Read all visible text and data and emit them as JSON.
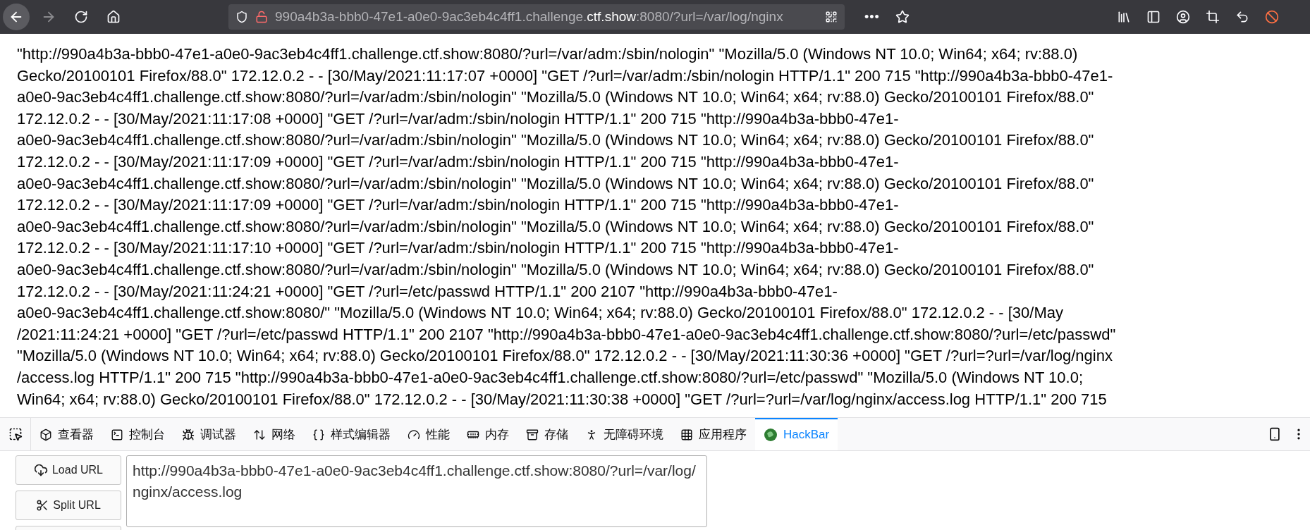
{
  "browser": {
    "back": {
      "disabled": false
    },
    "forward": {
      "disabled": true
    },
    "url_bar": {
      "prefix": "990a4b3a-bbb0-47e1-a0e0-9ac3eb4c4ff1.challenge.",
      "domain": "ctf.show",
      "suffix": ":8080/?url=/var/log/nginx",
      "menu": "•••"
    }
  },
  "log_lines": [
    "\"http://990a4b3a-bbb0-47e1-a0e0-9ac3eb4c4ff1.challenge.ctf.show:8080/?url=/var/adm:/sbin/nologin\" \"Mozilla/5.0 (Windows NT 10.0; Win64; x64; rv:88.0)",
    "Gecko/20100101 Firefox/88.0\" 172.12.0.2 - - [30/May/2021:11:17:07 +0000] \"GET /?url=/var/adm:/sbin/nologin HTTP/1.1\" 200 715 \"http://990a4b3a-bbb0-47e1-",
    "a0e0-9ac3eb4c4ff1.challenge.ctf.show:8080/?url=/var/adm:/sbin/nologin\" \"Mozilla/5.0 (Windows NT 10.0; Win64; x64; rv:88.0) Gecko/20100101 Firefox/88.0\"",
    "172.12.0.2 - - [30/May/2021:11:17:08 +0000] \"GET /?url=/var/adm:/sbin/nologin HTTP/1.1\" 200 715 \"http://990a4b3a-bbb0-47e1-",
    "a0e0-9ac3eb4c4ff1.challenge.ctf.show:8080/?url=/var/adm:/sbin/nologin\" \"Mozilla/5.0 (Windows NT 10.0; Win64; x64; rv:88.0) Gecko/20100101 Firefox/88.0\"",
    "172.12.0.2 - - [30/May/2021:11:17:09 +0000] \"GET /?url=/var/adm:/sbin/nologin HTTP/1.1\" 200 715 \"http://990a4b3a-bbb0-47e1-",
    "a0e0-9ac3eb4c4ff1.challenge.ctf.show:8080/?url=/var/adm:/sbin/nologin\" \"Mozilla/5.0 (Windows NT 10.0; Win64; x64; rv:88.0) Gecko/20100101 Firefox/88.0\"",
    "172.12.0.2 - - [30/May/2021:11:17:09 +0000] \"GET /?url=/var/adm:/sbin/nologin HTTP/1.1\" 200 715 \"http://990a4b3a-bbb0-47e1-",
    "a0e0-9ac3eb4c4ff1.challenge.ctf.show:8080/?url=/var/adm:/sbin/nologin\" \"Mozilla/5.0 (Windows NT 10.0; Win64; x64; rv:88.0) Gecko/20100101 Firefox/88.0\"",
    "172.12.0.2 - - [30/May/2021:11:17:10 +0000] \"GET /?url=/var/adm:/sbin/nologin HTTP/1.1\" 200 715 \"http://990a4b3a-bbb0-47e1-",
    "a0e0-9ac3eb4c4ff1.challenge.ctf.show:8080/?url=/var/adm:/sbin/nologin\" \"Mozilla/5.0 (Windows NT 10.0; Win64; x64; rv:88.0) Gecko/20100101 Firefox/88.0\"",
    "172.12.0.2 - - [30/May/2021:11:24:21 +0000] \"GET /?url=/etc/passwd HTTP/1.1\" 200 2107 \"http://990a4b3a-bbb0-47e1-",
    "a0e0-9ac3eb4c4ff1.challenge.ctf.show:8080/\" \"Mozilla/5.0 (Windows NT 10.0; Win64; x64; rv:88.0) Gecko/20100101 Firefox/88.0\" 172.12.0.2 - - [30/May",
    "/2021:11:24:21 +0000] \"GET /?url=/etc/passwd HTTP/1.1\" 200 2107 \"http://990a4b3a-bbb0-47e1-a0e0-9ac3eb4c4ff1.challenge.ctf.show:8080/?url=/etc/passwd\"",
    "\"Mozilla/5.0 (Windows NT 10.0; Win64; x64; rv:88.0) Gecko/20100101 Firefox/88.0\" 172.12.0.2 - - [30/May/2021:11:30:36 +0000] \"GET /?url=?url=/var/log/nginx",
    "/access.log HTTP/1.1\" 200 715 \"http://990a4b3a-bbb0-47e1-a0e0-9ac3eb4c4ff1.challenge.ctf.show:8080/?url=/etc/passwd\" \"Mozilla/5.0 (Windows NT 10.0;",
    "Win64; x64; rv:88.0) Gecko/20100101 Firefox/88.0\" 172.12.0.2 - - [30/May/2021:11:30:38 +0000] \"GET /?url=?url=/var/log/nginx/access.log HTTP/1.1\" 200 715"
  ],
  "devtools": {
    "tabs": [
      {
        "kind": "inspector",
        "label": "查看器",
        "selected": false
      },
      {
        "kind": "console",
        "label": "控制台",
        "selected": false
      },
      {
        "kind": "debugger",
        "label": "调试器",
        "selected": false
      },
      {
        "kind": "network",
        "label": "网络",
        "selected": false
      },
      {
        "kind": "style",
        "label": "样式编辑器",
        "selected": false
      },
      {
        "kind": "performance",
        "label": "性能",
        "selected": false
      },
      {
        "kind": "memory",
        "label": "内存",
        "selected": false
      },
      {
        "kind": "storage",
        "label": "存储",
        "selected": false
      },
      {
        "kind": "accessibility",
        "label": "无障碍环境",
        "selected": false
      },
      {
        "kind": "application",
        "label": "应用程序",
        "selected": false
      },
      {
        "kind": "hackbar",
        "label": "HackBar",
        "selected": true
      }
    ]
  },
  "hackbar": {
    "buttons": [
      {
        "kind": "load",
        "label": "Load URL"
      },
      {
        "kind": "split",
        "label": "Split URL"
      }
    ],
    "url_value": "http://990a4b3a-bbb0-47e1-a0e0-9ac3eb4c4ff1.challenge.ctf.show:8080/?url=/var/log/nginx/access.log"
  }
}
